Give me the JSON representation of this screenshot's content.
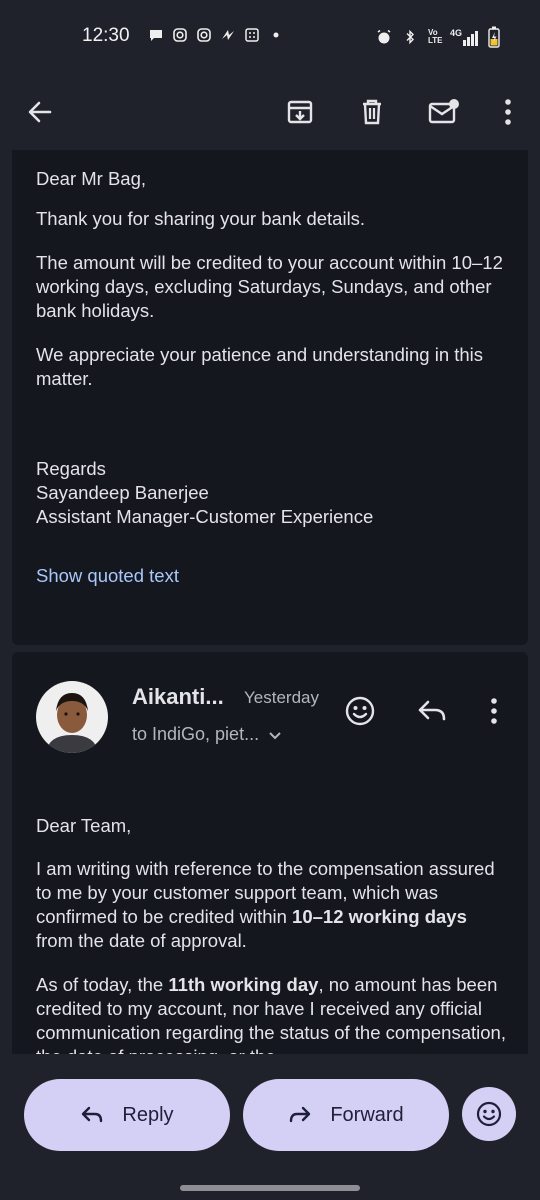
{
  "status_bar": {
    "time": "12:30",
    "icons_left": [
      "chat-bubble-icon",
      "instagram-icon",
      "instagram-icon",
      "zepto-icon",
      "calculator-icon",
      "dot-icon"
    ],
    "icons_right": [
      "alarm-icon",
      "bluetooth-icon",
      "volte-icon",
      "signal-4g-icon",
      "battery-charging-icon"
    ],
    "volte_label": "Vo LTE",
    "network_label": "4G"
  },
  "toolbar": {
    "actions": [
      "back-arrow-icon",
      "archive-icon",
      "delete-icon",
      "mark-unread-icon",
      "more-vert-icon"
    ]
  },
  "message1": {
    "greeting": "Dear Mr Bag,",
    "para1": "Thank you for sharing your bank details.",
    "para2": "The amount will be credited to your account within 10–12 working days, excluding Saturdays, Sundays, and other bank holidays.",
    "para3": "We appreciate your patience and understanding in this matter.",
    "signoff": "Regards",
    "sig_name": "Sayandeep Banerjee",
    "sig_title": "Assistant Manager-Customer Experience",
    "show_quoted": "Show quoted text"
  },
  "message2": {
    "sender": "Aikanti...",
    "time": "Yesterday",
    "to": "to IndiGo, piet...",
    "greeting": "Dear Team,",
    "p1_a": "I am writing with reference to the compensation assured to me by your customer support team, which was confirmed to be credited within ",
    "p1_bold": "10–12 working days",
    "p1_b": " from the date of approval.",
    "p2_a": "As of today, the ",
    "p2_bold": "11th working day",
    "p2_b": ", no amount has been credited to my account, nor have I received any official communication regarding the status of the compensation, the date of processing, or the"
  },
  "bottom": {
    "reply_label": "Reply",
    "forward_label": "Forward"
  },
  "colors": {
    "background": "#1f222b",
    "card": "#15171f",
    "accent_pill": "#d4d0f5",
    "link": "#a8c7fa"
  }
}
